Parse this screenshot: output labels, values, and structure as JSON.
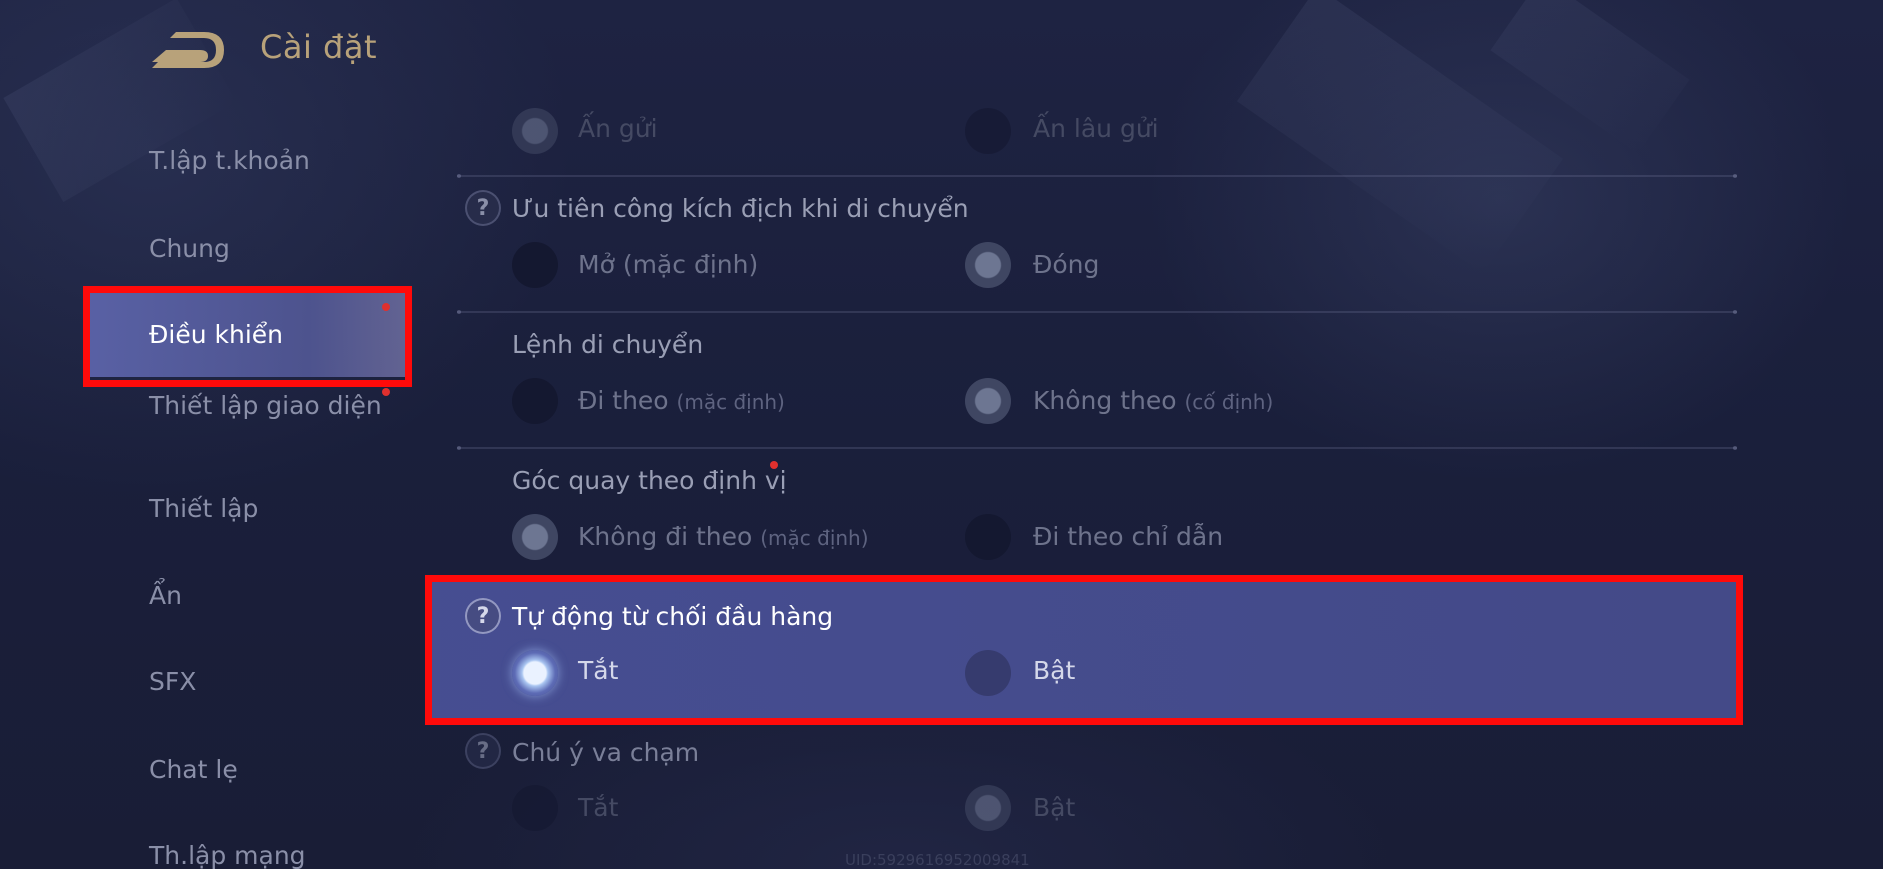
{
  "header": {
    "title": "Cài đặt",
    "back_icon": "back-arrow-icon"
  },
  "sidebar": {
    "items": [
      {
        "label": "T.lập t.khoản",
        "active": false
      },
      {
        "label": "Chung",
        "active": false
      },
      {
        "label": "Điều khiển",
        "active": true
      },
      {
        "label": "Thiết lập giao diện",
        "active": false
      },
      {
        "label": "Thiết lập",
        "active": false
      },
      {
        "label": "Ẩn",
        "active": false
      },
      {
        "label": "SFX",
        "active": false
      },
      {
        "label": "Chat lẹ",
        "active": false
      },
      {
        "label": "Th.lập mạng",
        "active": false
      }
    ]
  },
  "settings": [
    {
      "title": "",
      "options": [
        {
          "label": "Ấn gửi",
          "sub": "",
          "selected": true
        },
        {
          "label": "Ấn lâu gửi",
          "sub": "",
          "selected": false
        }
      ]
    },
    {
      "title": "Ưu tiên công kích địch khi di chuyển",
      "help": true,
      "options": [
        {
          "label": "Mở",
          "sub": "(mặc định)",
          "selected": false
        },
        {
          "label": "Đóng",
          "sub": "",
          "selected": true
        }
      ]
    },
    {
      "title": "Lệnh di chuyển",
      "help": false,
      "options": [
        {
          "label": "Đi theo",
          "sub": "(mặc định)",
          "selected": false
        },
        {
          "label": "Không theo",
          "sub": "(cố định)",
          "selected": true
        }
      ]
    },
    {
      "title": "Góc quay theo định vị",
      "help": false,
      "options": [
        {
          "label": "Không đi theo",
          "sub": "(mặc định)",
          "selected": true
        },
        {
          "label": "Đi theo chỉ dẫn",
          "sub": "",
          "selected": false
        }
      ]
    },
    {
      "title": "Tự động từ chối đầu hàng",
      "help": true,
      "highlighted": true,
      "options": [
        {
          "label": "Tắt",
          "sub": "",
          "selected": true
        },
        {
          "label": "Bật",
          "sub": "",
          "selected": false
        }
      ]
    },
    {
      "title": "Chú ý va chạm",
      "help": true,
      "options": [
        {
          "label": "Tắt",
          "sub": "",
          "selected": false
        },
        {
          "label": "Bật",
          "sub": "",
          "selected": true
        }
      ]
    }
  ],
  "footer": {
    "uid": "UID:5929616952009841"
  },
  "colors": {
    "background": "#1a1f3a",
    "title_gold": "#b8a27a",
    "active_tab": "#5c64aa",
    "highlight_red": "#ff0a0a"
  }
}
